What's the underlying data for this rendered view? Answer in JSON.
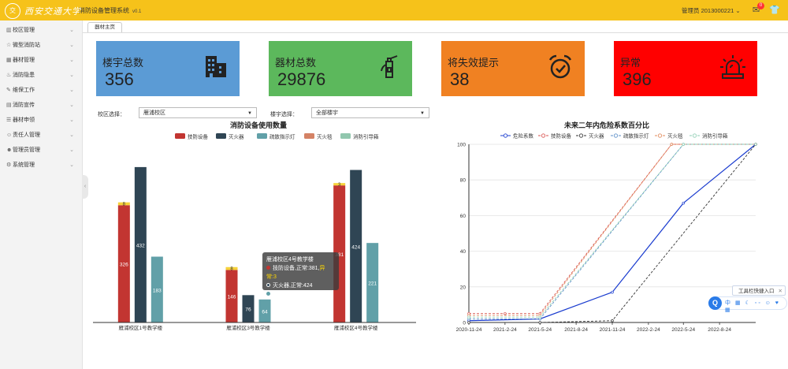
{
  "header": {
    "logo_mark": "交",
    "logo_text": "西安交通大学",
    "app_title": "消防设备管理系统",
    "version": "v0.1",
    "user_label": "管理员 2013000221",
    "notification_count": "0"
  },
  "sidebar": {
    "items": [
      {
        "label": "校区管理",
        "icon": "building-icon"
      },
      {
        "label": "微型消防站",
        "icon": "star-icon"
      },
      {
        "label": "器材管理",
        "icon": "grid-icon"
      },
      {
        "label": "消防隐患",
        "icon": "fire-icon"
      },
      {
        "label": "维保工作",
        "icon": "wrench-icon"
      },
      {
        "label": "消防宣传",
        "icon": "book-icon"
      },
      {
        "label": "器材申领",
        "icon": "list-icon"
      },
      {
        "label": "责任人管理",
        "icon": "user-icon"
      },
      {
        "label": "管理员管理",
        "icon": "admin-icon"
      },
      {
        "label": "系统管理",
        "icon": "gear-icon"
      }
    ]
  },
  "tabs": {
    "active": "器材主页"
  },
  "cards": [
    {
      "label": "楼宇总数",
      "value": "356",
      "color": "#5b9bd5",
      "icon": "building-icon"
    },
    {
      "label": "器材总数",
      "value": "29876",
      "color": "#5cb85c",
      "icon": "fire-extinguisher-icon"
    },
    {
      "label": "将失效提示",
      "value": "38",
      "color": "#f08122",
      "icon": "alarm-clock-icon"
    },
    {
      "label": "异常",
      "value": "396",
      "color": "#ff0000",
      "icon": "siren-icon"
    }
  ],
  "filters": {
    "campus_label": "校区选择：",
    "campus_value": "雁浦校区",
    "building_label": "楼宇选择：",
    "building_value": "全部楼宇"
  },
  "tooltip": {
    "title": "雁浦校区4号教学楼",
    "line1": "技防设备,正常:381,",
    "line1_abnormal": "异常:3",
    "line2": "灭火器,正常:424",
    "line3": "疏散指示灯,正常:221"
  },
  "toolbox": {
    "label": "工具栏快捷入口"
  },
  "ime": {
    "q": "Q",
    "items": "中 ▦ ☾ ◦◦ ☺ ♥ ▦"
  },
  "chart_data": [
    {
      "type": "bar",
      "title": "消防设备使用数量",
      "categories": [
        "雁浦校区1号教学楼",
        "雁浦校区3号教学楼",
        "雁浦校区4号教学楼"
      ],
      "series": [
        {
          "name": "技防设备",
          "color": "#c23531",
          "values": [
            326,
            146,
            381
          ],
          "abnormal": [
            8,
            8,
            3
          ]
        },
        {
          "name": "灭火器",
          "color": "#2f4554",
          "values": [
            432,
            76,
            424
          ]
        },
        {
          "name": "疏散指示灯",
          "color": "#61a0a8",
          "values": [
            183,
            64,
            221
          ]
        },
        {
          "name": "灭火毯",
          "color": "#d48265",
          "values": [
            0,
            0,
            0
          ]
        },
        {
          "name": "消防引导箱",
          "color": "#91c7ae",
          "values": [
            0,
            0,
            0
          ]
        }
      ],
      "highlight_category": 2,
      "ylim": [
        0,
        480
      ],
      "grid": false,
      "legend": "top"
    },
    {
      "type": "line",
      "title": "未来二年内危险系数百分比",
      "x": [
        "2020-11-24",
        "2021-2-24",
        "2021-5-24",
        "2021-8-24",
        "2021-11-24",
        "2022-2-24",
        "2022-5-24",
        "2022-8-24"
      ],
      "x_end": "2022-11-24",
      "y_ticks": [
        0,
        20,
        40,
        60,
        80,
        100
      ],
      "ylim": [
        0,
        100
      ],
      "series": [
        {
          "name": "危险系数",
          "color": "#1a3ccf",
          "dash": "",
          "points": [
            [
              "2020-11-24",
              1
            ],
            [
              "2021-5-24",
              2
            ],
            [
              "2021-11-24",
              17
            ],
            [
              "2022-5-24",
              67
            ],
            [
              "2022-11-24",
              100
            ]
          ]
        },
        {
          "name": "技防设备",
          "color": "#d9534f",
          "dash": "3,2",
          "points": [
            [
              "2020-11-24",
              5
            ],
            [
              "2021-2-24",
              5
            ],
            [
              "2021-5-24",
              5
            ],
            [
              "2022-4-24",
              100
            ],
            [
              "2022-11-24",
              100
            ]
          ]
        },
        {
          "name": "灭火器",
          "color": "#333333",
          "dash": "3,2",
          "points": [
            [
              "2020-11-24",
              0
            ],
            [
              "2021-5-24",
              0
            ],
            [
              "2021-11-24",
              1
            ],
            [
              "2022-11-24",
              100
            ]
          ]
        },
        {
          "name": "疏散指示灯",
          "color": "#5b8ec7",
          "dash": "3,2",
          "points": [
            [
              "2020-11-24",
              2
            ],
            [
              "2021-5-24",
              2
            ],
            [
              "2022-5-24",
              100
            ],
            [
              "2022-11-24",
              100
            ]
          ]
        },
        {
          "name": "灭火毯",
          "color": "#e08a5b",
          "dash": "3,2",
          "points": [
            [
              "2020-11-24",
              4
            ],
            [
              "2021-5-24",
              4
            ],
            [
              "2022-4-24",
              100
            ],
            [
              "2022-11-24",
              100
            ]
          ]
        },
        {
          "name": "消防引导箱",
          "color": "#8ecdb3",
          "dash": "3,2",
          "points": [
            [
              "2020-11-24",
              3
            ],
            [
              "2021-5-24",
              3
            ],
            [
              "2022-5-24",
              100
            ],
            [
              "2022-11-24",
              100
            ]
          ]
        }
      ],
      "grid": true,
      "legend": "top"
    }
  ]
}
